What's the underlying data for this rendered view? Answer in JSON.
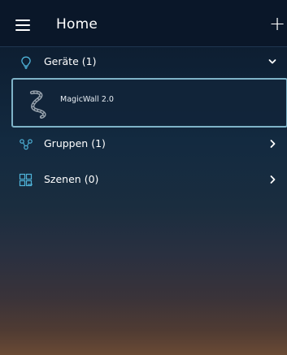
{
  "header": {
    "title": "Home",
    "menu_icon": "hamburger-menu-icon",
    "add_label": "+"
  },
  "sections": {
    "devices": {
      "label": "Geräte (1)",
      "icon": "lightbulb-icon",
      "expanded": true,
      "chevron": "chevron-down-icon"
    },
    "groups": {
      "label": "Gruppen (1)",
      "icon": "group-icon",
      "expanded": false,
      "chevron": "chevron-right-icon"
    },
    "scenes": {
      "label": "Szenen (0)",
      "icon": "scenes-icon",
      "expanded": false,
      "chevron": "chevron-right-icon"
    }
  },
  "devices": [
    {
      "name": "MagicWall 2.0",
      "icon": "led-strip-icon",
      "selected": true
    }
  ],
  "colors": {
    "accent": "#4fb3d9",
    "card_border": "#7fb3c8",
    "topbar": "#0a1729"
  }
}
